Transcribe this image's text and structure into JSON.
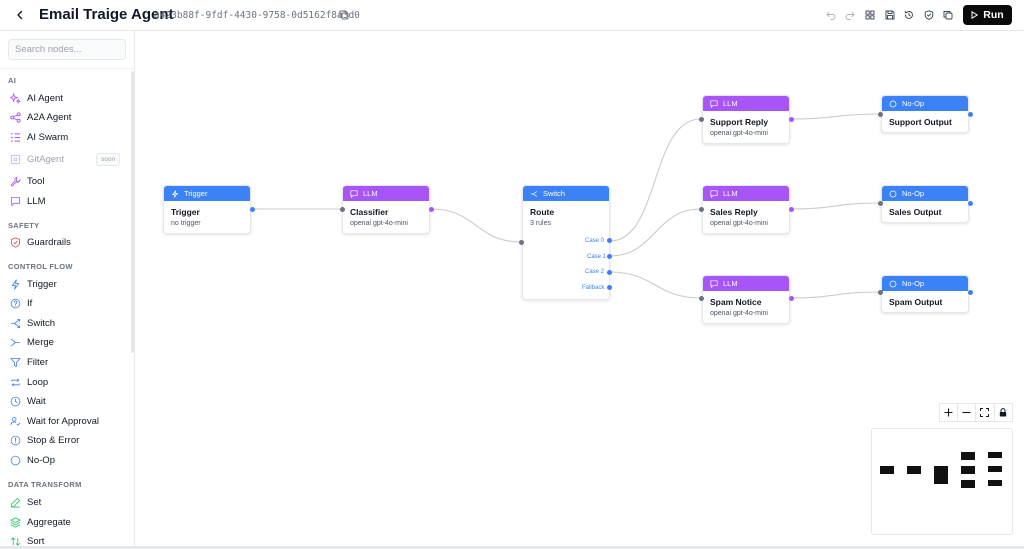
{
  "header": {
    "title": "Email Traige Agent",
    "agent_id": "a423b88f-9fdf-4430-9758-0d5162f8a3d0",
    "run_label": "Run"
  },
  "sidebar": {
    "search_placeholder": "Search nodes...",
    "sections": [
      {
        "label": "AI",
        "items": [
          {
            "label": "AI Agent",
            "icon": "sparkles-icon"
          },
          {
            "label": "A2A Agent",
            "icon": "share-nodes-icon"
          },
          {
            "label": "AI Swarm",
            "icon": "list-tree-icon"
          },
          {
            "label": "GitAgent",
            "icon": "git-icon",
            "badge": "soon"
          },
          {
            "label": "Tool",
            "icon": "wrench-icon"
          },
          {
            "label": "LLM",
            "icon": "message-icon"
          }
        ]
      },
      {
        "label": "SAFETY",
        "items": [
          {
            "label": "Guardrails",
            "icon": "shield-icon"
          }
        ]
      },
      {
        "label": "CONTROL FLOW",
        "items": [
          {
            "label": "Trigger",
            "icon": "bolt-icon"
          },
          {
            "label": "If",
            "icon": "question-icon"
          },
          {
            "label": "Switch",
            "icon": "switch-icon"
          },
          {
            "label": "Merge",
            "icon": "merge-icon"
          },
          {
            "label": "Filter",
            "icon": "filter-icon"
          },
          {
            "label": "Loop",
            "icon": "loop-icon"
          },
          {
            "label": "Wait",
            "icon": "clock-icon"
          },
          {
            "label": "Wait for Approval",
            "icon": "user-check-icon"
          },
          {
            "label": "Stop & Error",
            "icon": "stop-icon"
          },
          {
            "label": "No-Op",
            "icon": "circle-icon"
          }
        ]
      },
      {
        "label": "DATA TRANSFORM",
        "items": [
          {
            "label": "Set",
            "icon": "pencil-icon"
          },
          {
            "label": "Aggregate",
            "icon": "layers-icon"
          },
          {
            "label": "Sort",
            "icon": "sort-icon"
          }
        ]
      }
    ]
  },
  "nodes": {
    "trigger": {
      "type": "Trigger",
      "title": "Trigger",
      "subtitle": "no trigger"
    },
    "classifier": {
      "type": "LLM",
      "title": "Classifier",
      "subtitle": "openai gpt-4o-mini"
    },
    "route": {
      "type": "Switch",
      "title": "Route",
      "subtitle": "3 rules",
      "cases": [
        "Case 0",
        "Case 1",
        "Case 2",
        "Fallback"
      ]
    },
    "support_reply": {
      "type": "LLM",
      "title": "Support Reply",
      "subtitle": "openai gpt-4o-mini"
    },
    "sales_reply": {
      "type": "LLM",
      "title": "Sales Reply",
      "subtitle": "openai gpt-4o-mini"
    },
    "spam_notice": {
      "type": "LLM",
      "title": "Spam Notice",
      "subtitle": "openai gpt-4o-mini"
    },
    "support_output": {
      "type": "No-Op",
      "title": "Support Output"
    },
    "sales_output": {
      "type": "No-Op",
      "title": "Sales Output"
    },
    "spam_output": {
      "type": "No-Op",
      "title": "Spam Output"
    }
  },
  "colors": {
    "blue": "#3b82f6",
    "purple": "#a855f7",
    "edge": "#c8cbd0"
  }
}
